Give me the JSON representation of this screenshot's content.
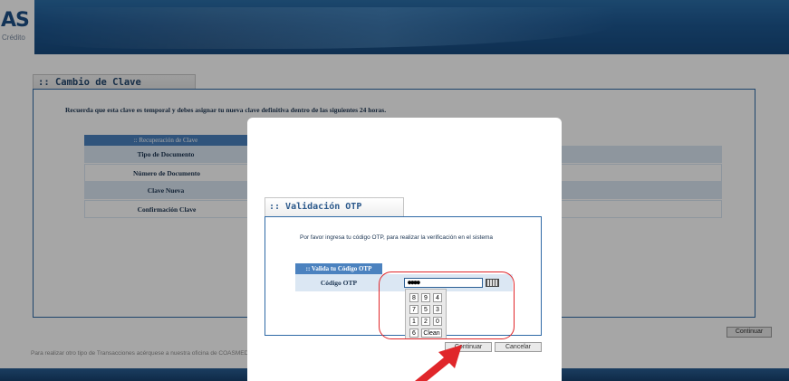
{
  "header": {
    "logo_text": "AS",
    "logo_sub": "Crédito"
  },
  "page": {
    "section_title": ":: Cambio de Clave",
    "notice": "Recuerda que esta clave es temporal y debes asignar tu nueva clave definitiva dentro de las siguientes 24 horas.",
    "recovery_header": ":: Recuperación de Clave",
    "recovery_rows": [
      "Tipo de Documento",
      "Número de Documento",
      "Clave Nueva",
      "Confirmación Clave"
    ],
    "continuar_label": "Continuar",
    "footer_text": "Para realizar otro tipo de Transacciones acérquese a nuestra oficina de COASMED"
  },
  "modal": {
    "title": ":: Validación OTP",
    "instructions": "Por favor ingresa tu código OTP, para realizar la verificación en el sistema",
    "table_header": ":: Valida tu Código OTP",
    "field_label": "Código OTP",
    "field_value": "●●●●",
    "keypad": [
      [
        "8",
        "9",
        "4"
      ],
      [
        "7",
        "5",
        "3"
      ],
      [
        "1",
        "2",
        "0"
      ],
      [
        "6",
        "Clean"
      ]
    ],
    "continuar_label": "Continuar",
    "cancelar_label": "Cancelar"
  },
  "colors": {
    "header_blue": "#1e5892",
    "table_header_blue": "#4b82bf",
    "row_light_blue": "#dbe7f3",
    "highlight_red": "#e0262a"
  }
}
